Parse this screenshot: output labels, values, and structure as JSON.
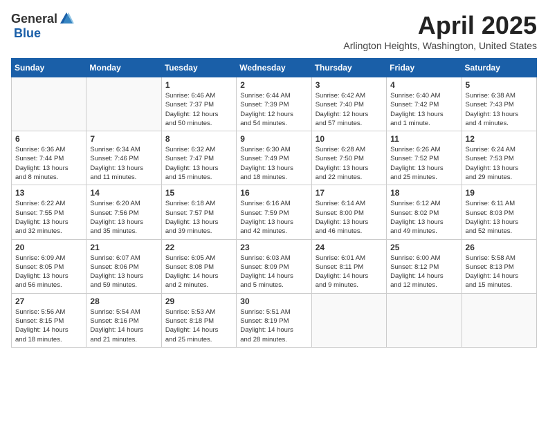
{
  "header": {
    "logo_general": "General",
    "logo_blue": "Blue",
    "month_title": "April 2025",
    "location": "Arlington Heights, Washington, United States"
  },
  "weekdays": [
    "Sunday",
    "Monday",
    "Tuesday",
    "Wednesday",
    "Thursday",
    "Friday",
    "Saturday"
  ],
  "weeks": [
    [
      {
        "day": "",
        "info": ""
      },
      {
        "day": "",
        "info": ""
      },
      {
        "day": "1",
        "info": "Sunrise: 6:46 AM\nSunset: 7:37 PM\nDaylight: 12 hours\nand 50 minutes."
      },
      {
        "day": "2",
        "info": "Sunrise: 6:44 AM\nSunset: 7:39 PM\nDaylight: 12 hours\nand 54 minutes."
      },
      {
        "day": "3",
        "info": "Sunrise: 6:42 AM\nSunset: 7:40 PM\nDaylight: 12 hours\nand 57 minutes."
      },
      {
        "day": "4",
        "info": "Sunrise: 6:40 AM\nSunset: 7:42 PM\nDaylight: 13 hours\nand 1 minute."
      },
      {
        "day": "5",
        "info": "Sunrise: 6:38 AM\nSunset: 7:43 PM\nDaylight: 13 hours\nand 4 minutes."
      }
    ],
    [
      {
        "day": "6",
        "info": "Sunrise: 6:36 AM\nSunset: 7:44 PM\nDaylight: 13 hours\nand 8 minutes."
      },
      {
        "day": "7",
        "info": "Sunrise: 6:34 AM\nSunset: 7:46 PM\nDaylight: 13 hours\nand 11 minutes."
      },
      {
        "day": "8",
        "info": "Sunrise: 6:32 AM\nSunset: 7:47 PM\nDaylight: 13 hours\nand 15 minutes."
      },
      {
        "day": "9",
        "info": "Sunrise: 6:30 AM\nSunset: 7:49 PM\nDaylight: 13 hours\nand 18 minutes."
      },
      {
        "day": "10",
        "info": "Sunrise: 6:28 AM\nSunset: 7:50 PM\nDaylight: 13 hours\nand 22 minutes."
      },
      {
        "day": "11",
        "info": "Sunrise: 6:26 AM\nSunset: 7:52 PM\nDaylight: 13 hours\nand 25 minutes."
      },
      {
        "day": "12",
        "info": "Sunrise: 6:24 AM\nSunset: 7:53 PM\nDaylight: 13 hours\nand 29 minutes."
      }
    ],
    [
      {
        "day": "13",
        "info": "Sunrise: 6:22 AM\nSunset: 7:55 PM\nDaylight: 13 hours\nand 32 minutes."
      },
      {
        "day": "14",
        "info": "Sunrise: 6:20 AM\nSunset: 7:56 PM\nDaylight: 13 hours\nand 35 minutes."
      },
      {
        "day": "15",
        "info": "Sunrise: 6:18 AM\nSunset: 7:57 PM\nDaylight: 13 hours\nand 39 minutes."
      },
      {
        "day": "16",
        "info": "Sunrise: 6:16 AM\nSunset: 7:59 PM\nDaylight: 13 hours\nand 42 minutes."
      },
      {
        "day": "17",
        "info": "Sunrise: 6:14 AM\nSunset: 8:00 PM\nDaylight: 13 hours\nand 46 minutes."
      },
      {
        "day": "18",
        "info": "Sunrise: 6:12 AM\nSunset: 8:02 PM\nDaylight: 13 hours\nand 49 minutes."
      },
      {
        "day": "19",
        "info": "Sunrise: 6:11 AM\nSunset: 8:03 PM\nDaylight: 13 hours\nand 52 minutes."
      }
    ],
    [
      {
        "day": "20",
        "info": "Sunrise: 6:09 AM\nSunset: 8:05 PM\nDaylight: 13 hours\nand 56 minutes."
      },
      {
        "day": "21",
        "info": "Sunrise: 6:07 AM\nSunset: 8:06 PM\nDaylight: 13 hours\nand 59 minutes."
      },
      {
        "day": "22",
        "info": "Sunrise: 6:05 AM\nSunset: 8:08 PM\nDaylight: 14 hours\nand 2 minutes."
      },
      {
        "day": "23",
        "info": "Sunrise: 6:03 AM\nSunset: 8:09 PM\nDaylight: 14 hours\nand 5 minutes."
      },
      {
        "day": "24",
        "info": "Sunrise: 6:01 AM\nSunset: 8:11 PM\nDaylight: 14 hours\nand 9 minutes."
      },
      {
        "day": "25",
        "info": "Sunrise: 6:00 AM\nSunset: 8:12 PM\nDaylight: 14 hours\nand 12 minutes."
      },
      {
        "day": "26",
        "info": "Sunrise: 5:58 AM\nSunset: 8:13 PM\nDaylight: 14 hours\nand 15 minutes."
      }
    ],
    [
      {
        "day": "27",
        "info": "Sunrise: 5:56 AM\nSunset: 8:15 PM\nDaylight: 14 hours\nand 18 minutes."
      },
      {
        "day": "28",
        "info": "Sunrise: 5:54 AM\nSunset: 8:16 PM\nDaylight: 14 hours\nand 21 minutes."
      },
      {
        "day": "29",
        "info": "Sunrise: 5:53 AM\nSunset: 8:18 PM\nDaylight: 14 hours\nand 25 minutes."
      },
      {
        "day": "30",
        "info": "Sunrise: 5:51 AM\nSunset: 8:19 PM\nDaylight: 14 hours\nand 28 minutes."
      },
      {
        "day": "",
        "info": ""
      },
      {
        "day": "",
        "info": ""
      },
      {
        "day": "",
        "info": ""
      }
    ]
  ]
}
